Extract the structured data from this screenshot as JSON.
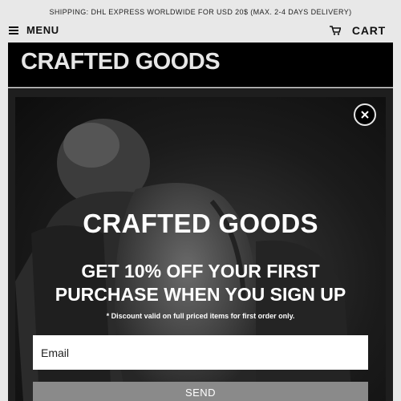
{
  "announcement": "SHIPPING: DHL EXPRESS WORLDWIDE FOR USD 20$ (MAX. 2-4 DAYS DELIVERY)",
  "nav": {
    "menu_label": "MENU",
    "menu_icon": "hamburger-icon",
    "cart_label": "CART",
    "cart_icon": "cart-icon"
  },
  "header": {
    "logo": "CRAFTED GOODS"
  },
  "popup": {
    "close_icon": "close-icon",
    "title": "CRAFTED GOODS",
    "offer_line1": "GET 10% OFF YOUR FIRST",
    "offer_line2": "PURCHASE WHEN YOU SIGN UP",
    "disclaimer": "* Discount valid on full priced items for first order only.",
    "email_placeholder": "Email",
    "email_value": "",
    "submit_label": "SEND",
    "background_image": "person-with-backpack-photo"
  },
  "colors": {
    "page_bg": "#e8e8e8",
    "header_bg": "#000000",
    "logo_text": "#e6e6e6",
    "send_button": "#8a8a8a"
  }
}
